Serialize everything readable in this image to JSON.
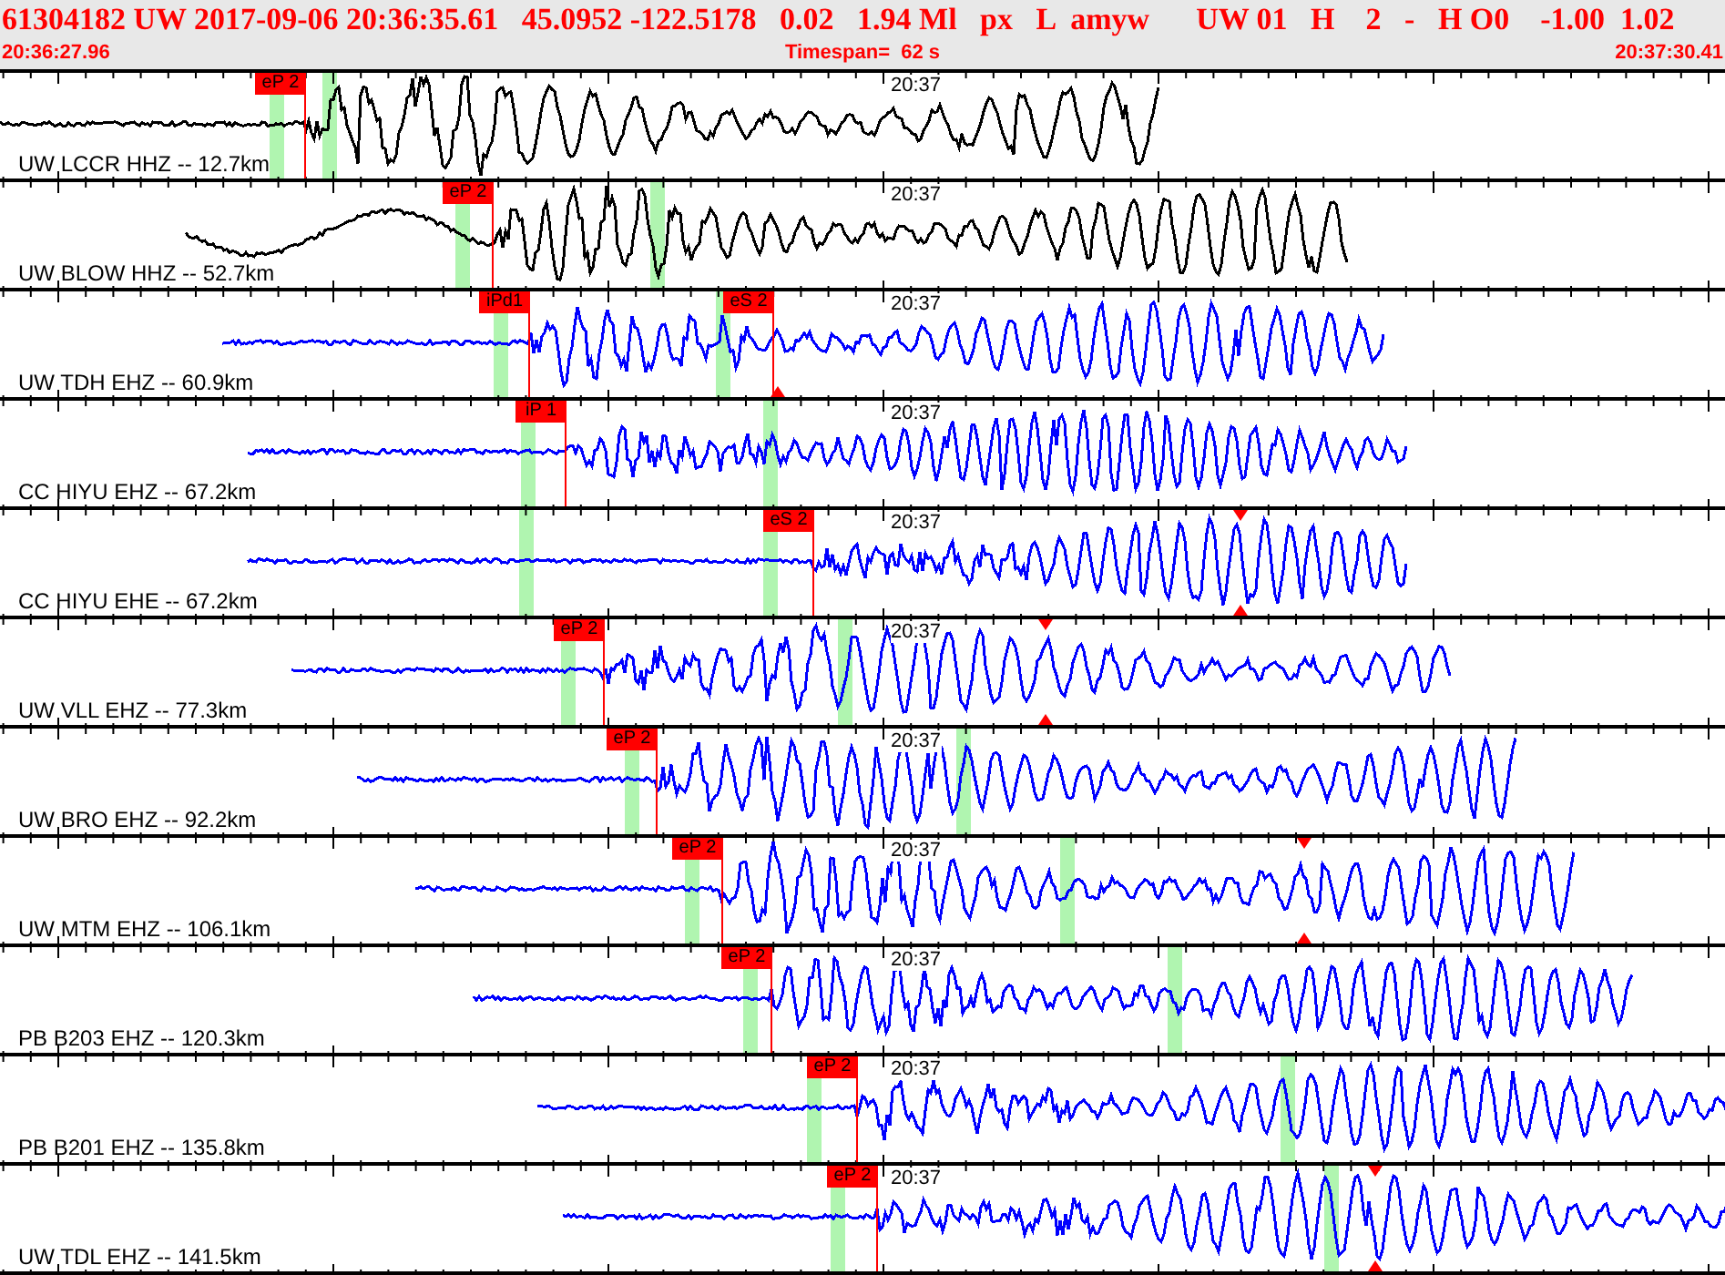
{
  "header": {
    "event_line": "61304182 UW 2017-09-06 20:36:35.61   45.0952 -122.5178   0.02   1.94 Ml   px   L  amyw      UW 01   H    2   -   H O0    -1.00  1.02",
    "start_time": "20:36:27.96",
    "timespan": "Timespan=  62 s",
    "end_time": "20:37:30.41"
  },
  "traces": [
    {
      "label": "UW LCCR HHZ -- 12.7km",
      "time_mark": "20:37",
      "color": "#000000",
      "picks": [
        {
          "label": "eP 2"
        }
      ]
    },
    {
      "label": "UW BLOW HHZ -- 52.7km",
      "time_mark": "20:37",
      "color": "#000000",
      "picks": [
        {
          "label": "eP 2"
        }
      ]
    },
    {
      "label": "UW TDH EHZ -- 60.9km",
      "time_mark": "20:37",
      "color": "#0000ff",
      "picks": [
        {
          "label": "iPd1"
        },
        {
          "label": "eS 2"
        }
      ]
    },
    {
      "label": "CC HIYU EHZ -- 67.2km",
      "time_mark": "20:37",
      "color": "#0000ff",
      "picks": [
        {
          "label": "iP 1"
        }
      ]
    },
    {
      "label": "CC HIYU EHE -- 67.2km",
      "time_mark": "20:37",
      "color": "#0000ff",
      "picks": [
        {
          "label": "eS 2"
        }
      ]
    },
    {
      "label": "UW VLL EHZ -- 77.3km",
      "time_mark": "20:37",
      "color": "#0000ff",
      "picks": [
        {
          "label": "eP 2"
        }
      ]
    },
    {
      "label": "UW BRO EHZ -- 92.2km",
      "time_mark": "20:37",
      "color": "#0000ff",
      "picks": [
        {
          "label": "eP 2"
        }
      ]
    },
    {
      "label": "UW MTM EHZ -- 106.1km",
      "time_mark": "20:37",
      "color": "#0000ff",
      "picks": [
        {
          "label": "eP 2"
        }
      ]
    },
    {
      "label": "PB B203 EHZ -- 120.3km",
      "time_mark": "20:37",
      "color": "#0000ff",
      "picks": [
        {
          "label": "eP 2"
        }
      ]
    },
    {
      "label": "PB B201 EHZ -- 135.8km",
      "time_mark": "20:37",
      "color": "#0000ff",
      "picks": [
        {
          "label": "eP 2"
        }
      ]
    },
    {
      "label": "UW TDL EHZ -- 141.5km",
      "time_mark": "20:37",
      "color": "#0000ff",
      "picks": [
        {
          "label": "eP 2"
        }
      ]
    }
  ]
}
